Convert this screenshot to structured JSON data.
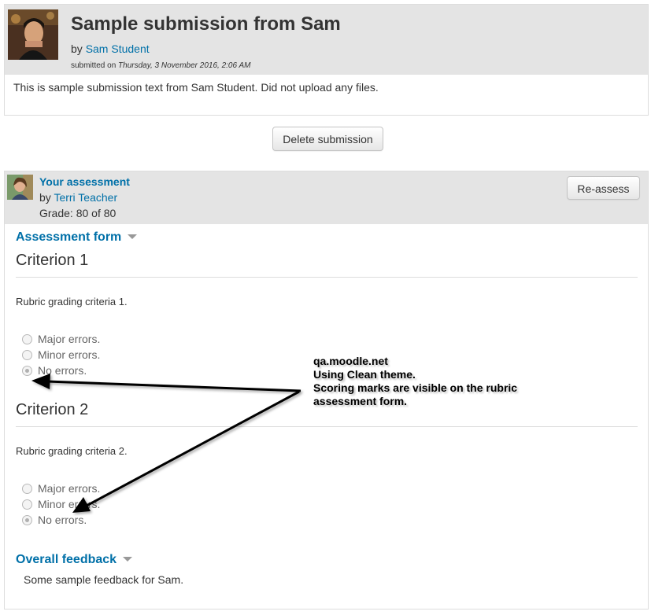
{
  "submission": {
    "title": "Sample submission from Sam",
    "by_prefix": "by ",
    "author": "Sam Student",
    "submitted_prefix": "submitted on ",
    "submitted_date": "Thursday, 3 November 2016, 2:06 AM",
    "content": "This is sample submission text from Sam Student. Did not upload any files."
  },
  "actions": {
    "delete_label": "Delete submission"
  },
  "assessment": {
    "title": "Your assessment",
    "by_prefix": "by ",
    "assessor": "Terri Teacher",
    "grade": "Grade: 80 of 80",
    "reassess_label": "Re-assess",
    "form_heading": "Assessment form",
    "criteria": [
      {
        "title": "Criterion 1",
        "description": "Rubric grading criteria 1.",
        "options": [
          "Major errors.",
          "Minor errors.",
          "No errors."
        ],
        "selected": 2
      },
      {
        "title": "Criterion 2",
        "description": "Rubric grading criteria 2.",
        "options": [
          "Major errors.",
          "Minor errors.",
          "No errors."
        ],
        "selected": 2
      }
    ],
    "feedback_heading": "Overall feedback",
    "feedback_text": "Some sample feedback for Sam."
  },
  "annotation": {
    "lines": [
      "qa.moodle.net",
      "Using Clean theme.",
      "Scoring marks are visible on the rubric",
      "assessment form."
    ]
  },
  "colors": {
    "link": "#0070a8",
    "header_bg": "#e4e4e4"
  }
}
